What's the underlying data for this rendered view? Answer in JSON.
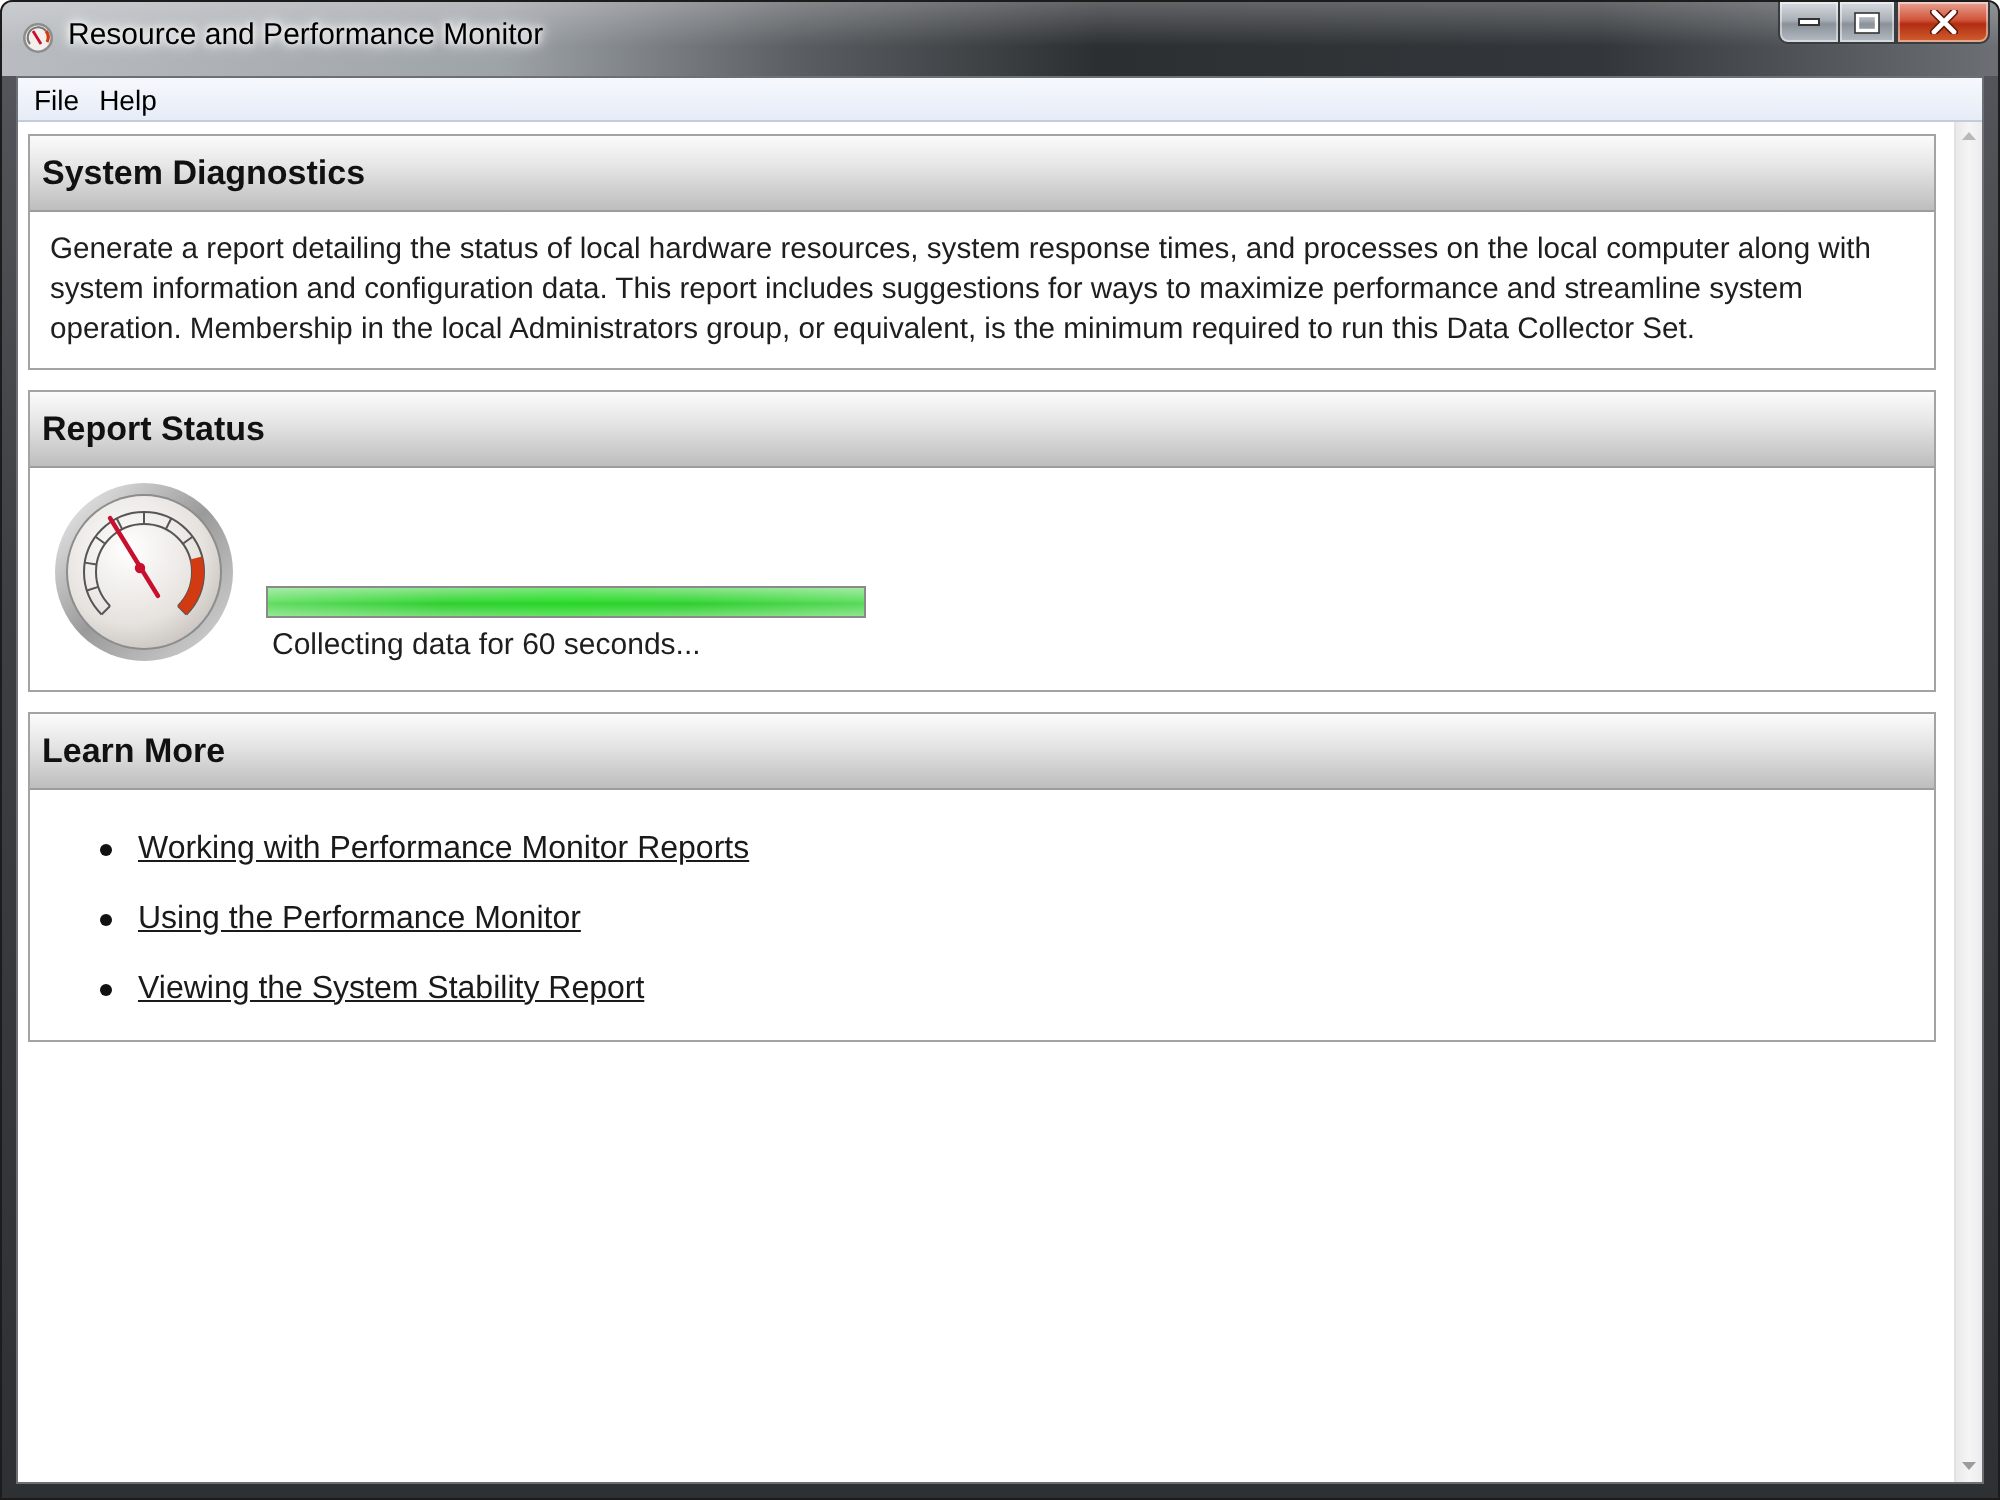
{
  "window": {
    "title": "Resource and Performance Monitor"
  },
  "menu": [
    "File",
    "Help"
  ],
  "sections": [
    {
      "kind": "text",
      "title": "System Diagnostics",
      "text": "Generate a report detailing the status of local hardware resources, system response times, and processes on the local computer along with system information and configuration data. This report includes suggestions for ways to maximize performance and streamline system operation. Membership in the local Administrators group, or equivalent, is the minimum required to run this Data Collector Set."
    },
    {
      "kind": "status",
      "title": "Report Status",
      "progress": {
        "level": 1,
        "caption": "Collecting data for 60 seconds..."
      }
    },
    {
      "kind": "links",
      "title": "Learn More",
      "links": [
        "Working with Performance Monitor Reports",
        "Using the Performance Monitor",
        "Viewing the System Stability Report"
      ]
    }
  ]
}
